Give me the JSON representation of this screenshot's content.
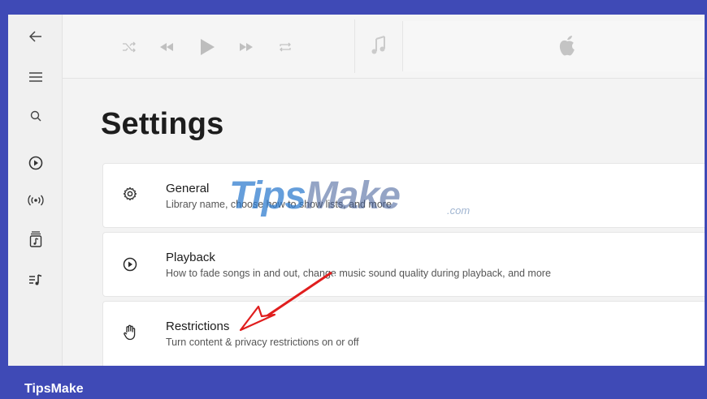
{
  "sidebar": {
    "items": [
      {
        "icon": "back-arrow-icon"
      },
      {
        "icon": "menu-icon"
      },
      {
        "icon": "search-icon"
      },
      {
        "icon": "play-circle-icon"
      },
      {
        "icon": "radio-icon"
      },
      {
        "icon": "library-icon"
      },
      {
        "icon": "playlist-icon"
      }
    ]
  },
  "toolbar": {
    "icons": [
      "shuffle-icon",
      "previous-icon",
      "play-icon",
      "next-icon",
      "repeat-icon",
      "music-note-icon",
      "apple-logo-icon"
    ]
  },
  "page": {
    "title": "Settings"
  },
  "settings": [
    {
      "label": "General",
      "description": "Library name, choose how to show lists, and more",
      "icon": "gear-icon"
    },
    {
      "label": "Playback",
      "description": "How to fade songs in and out, change music sound quality during playback, and more",
      "icon": "play-circle-icon"
    },
    {
      "label": "Restrictions",
      "description": "Turn content & privacy restrictions on or off",
      "icon": "hand-icon"
    }
  ],
  "watermark": {
    "main": "Tips",
    "accent": "Make",
    "suffix": ".com"
  },
  "footer": {
    "brand": "TipsMake"
  },
  "colors": {
    "frame_border": "#3f4ab6",
    "annotation_arrow": "#e01e1e"
  }
}
